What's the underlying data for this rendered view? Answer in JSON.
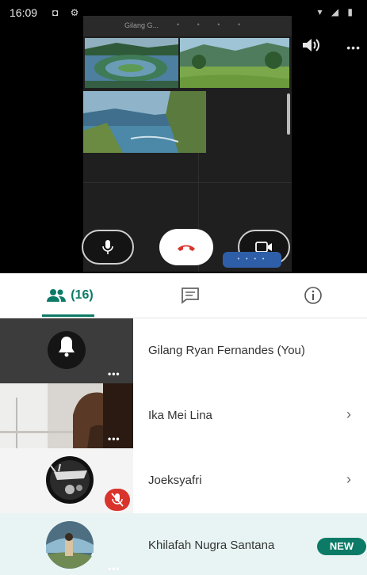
{
  "status_bar": {
    "time": "16:09",
    "left_icons": "◘ ⚙",
    "right_icons": "▾ ◢ ▮"
  },
  "call": {
    "shared_title": "Gilang G...",
    "shared_toolbar": "• • • •",
    "more_label": "•••",
    "share_pill": "• • • •",
    "colors": {
      "end_call": "#d9342b",
      "accent": "#0b7a66"
    }
  },
  "tabs": {
    "people_count": "(16)",
    "active": "people"
  },
  "participants": [
    {
      "name": "Gilang Ryan Fernandes (You)",
      "tile_menu": "•••",
      "has_chevron": false
    },
    {
      "name": "Ika Mei Lina",
      "tile_menu": "•••",
      "has_chevron": true
    },
    {
      "name": "Joeksyafri",
      "tile_menu": "",
      "has_chevron": true,
      "muted": true
    },
    {
      "name": "Khilafah Nugra Santana",
      "tile_menu": "•••",
      "badge": "NEW"
    }
  ],
  "chevron": "›"
}
